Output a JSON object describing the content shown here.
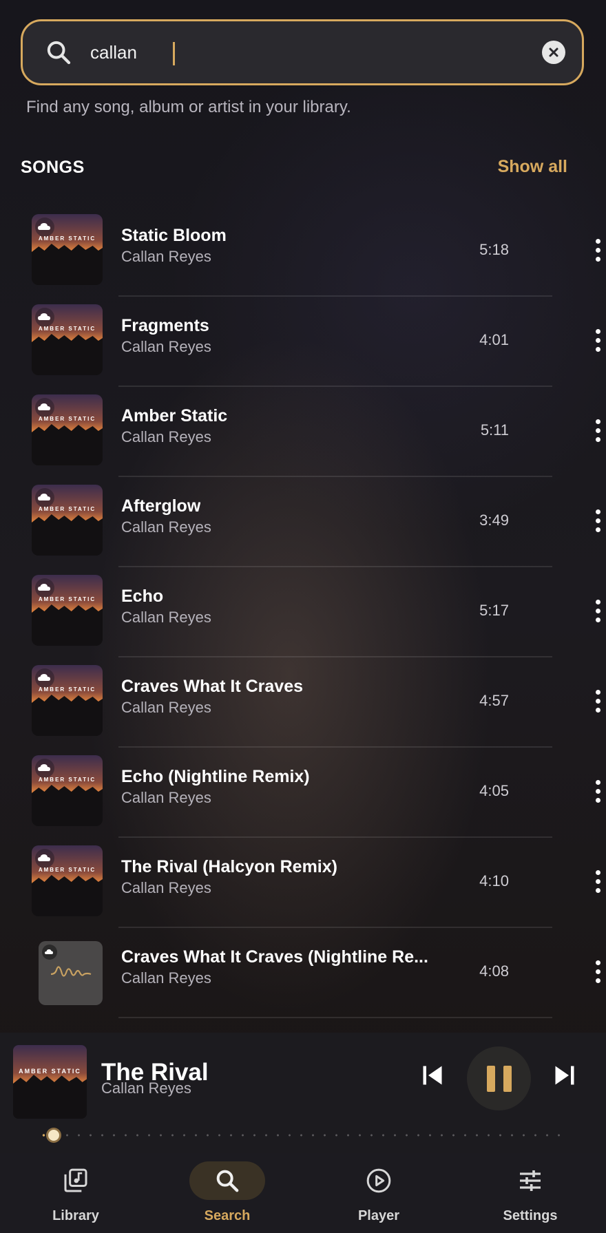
{
  "search": {
    "value": "callan",
    "placeholder": "",
    "hint": "Find any song, album or artist in your library."
  },
  "songs_section": {
    "title": "SONGS",
    "show_all_label": "Show all"
  },
  "album_art_text": "AMBER STATIC",
  "songs": [
    {
      "title": "Static Bloom",
      "artist": "Callan Reyes",
      "duration": "5:18",
      "art": "amber-static"
    },
    {
      "title": "Fragments",
      "artist": "Callan Reyes",
      "duration": "4:01",
      "art": "amber-static"
    },
    {
      "title": "Amber Static",
      "artist": "Callan Reyes",
      "duration": "5:11",
      "art": "amber-static"
    },
    {
      "title": "Afterglow",
      "artist": "Callan Reyes",
      "duration": "3:49",
      "art": "amber-static"
    },
    {
      "title": "Echo",
      "artist": "Callan Reyes",
      "duration": "5:17",
      "art": "amber-static"
    },
    {
      "title": "Craves What It Craves",
      "artist": "Callan Reyes",
      "duration": "4:57",
      "art": "amber-static"
    },
    {
      "title": "Echo (Nightline Remix)",
      "artist": "Callan Reyes",
      "duration": "4:05",
      "art": "amber-static"
    },
    {
      "title": "The Rival (Halcyon Remix)",
      "artist": "Callan Reyes",
      "duration": "4:10",
      "art": "amber-static"
    },
    {
      "title": "Craves What It Craves (Nightline Re...",
      "artist": "Callan Reyes",
      "duration": "4:08",
      "art": "waveform"
    }
  ],
  "now_playing": {
    "title": "The Rival",
    "artist": "Callan Reyes",
    "progress_fraction": 0.03
  },
  "nav": {
    "library": "Library",
    "search": "Search",
    "player": "Player",
    "settings": "Settings",
    "active": "search"
  },
  "colors": {
    "accent": "#d7a95e",
    "background": "#16151a"
  }
}
